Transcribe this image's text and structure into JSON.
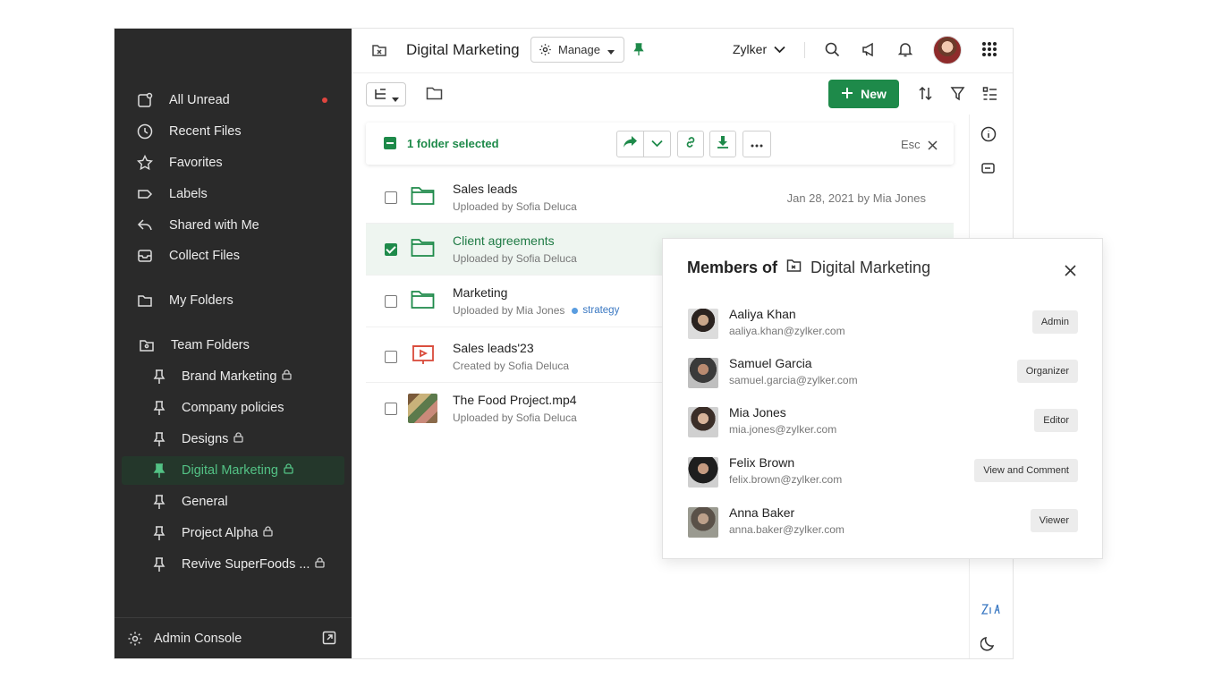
{
  "sidebar": {
    "items": [
      {
        "label": "All Unread",
        "icon": "all-unread-icon"
      },
      {
        "label": "Recent Files",
        "icon": "clock-icon"
      },
      {
        "label": "Favorites",
        "icon": "star-icon"
      },
      {
        "label": "Labels",
        "icon": "label-icon"
      },
      {
        "label": "Shared with Me",
        "icon": "share-back-icon"
      },
      {
        "label": "Collect Files",
        "icon": "inbox-icon"
      }
    ],
    "my_folders": "My Folders",
    "team_folders": "Team Folders",
    "team_items": [
      {
        "label": "Brand Marketing",
        "locked": true
      },
      {
        "label": "Company policies",
        "locked": false
      },
      {
        "label": "Designs",
        "locked": true
      },
      {
        "label": "Digital Marketing",
        "locked": true,
        "active": true
      },
      {
        "label": "General",
        "locked": false
      },
      {
        "label": "Project Alpha",
        "locked": true
      },
      {
        "label": "Revive SuperFoods ...",
        "locked": true
      }
    ],
    "admin_console": "Admin Console"
  },
  "header": {
    "title": "Digital Marketing",
    "manage_label": "Manage",
    "org": "Zylker"
  },
  "toolbar": {
    "new_label": "New"
  },
  "selection": {
    "text": "1 folder selected",
    "esc": "Esc"
  },
  "files": [
    {
      "name": "Sales leads",
      "sub": "Uploaded by Sofia Deluca",
      "date": "Jan 28, 2021 by Mia Jones",
      "type": "folder",
      "checked": false
    },
    {
      "name": "Client agreements",
      "sub": "Uploaded by Sofia Deluca",
      "date": "",
      "type": "folder",
      "checked": true
    },
    {
      "name": "Marketing",
      "sub": "Uploaded by Mia Jones",
      "tag": "strategy",
      "date": "",
      "type": "folder",
      "checked": false
    },
    {
      "name": "Sales leads'23",
      "sub": "Created by Sofia Deluca",
      "date": "",
      "type": "presentation",
      "checked": false
    },
    {
      "name": "The Food Project.mp4",
      "sub": "Uploaded by Sofia Deluca",
      "date": "",
      "type": "video",
      "checked": false
    }
  ],
  "members_popup": {
    "title_prefix": "Members of",
    "folder_name": "Digital Marketing",
    "members": [
      {
        "name": "Aaliya Khan",
        "email": "aaliya.khan@zylker.com",
        "role": "Admin"
      },
      {
        "name": "Samuel Garcia",
        "email": "samuel.garcia@zylker.com",
        "role": "Organizer"
      },
      {
        "name": "Mia Jones",
        "email": "mia.jones@zylker.com",
        "role": "Editor"
      },
      {
        "name": "Felix Brown",
        "email": "felix.brown@zylker.com",
        "role": "View and Comment"
      },
      {
        "name": "Anna Baker",
        "email": "anna.baker@zylker.com",
        "role": "Viewer"
      }
    ]
  },
  "colors": {
    "accent": "#1e8a4a",
    "sidebar_bg": "#2a2a2a",
    "active_text": "#53c285",
    "unread_dot": "#e0453f"
  }
}
